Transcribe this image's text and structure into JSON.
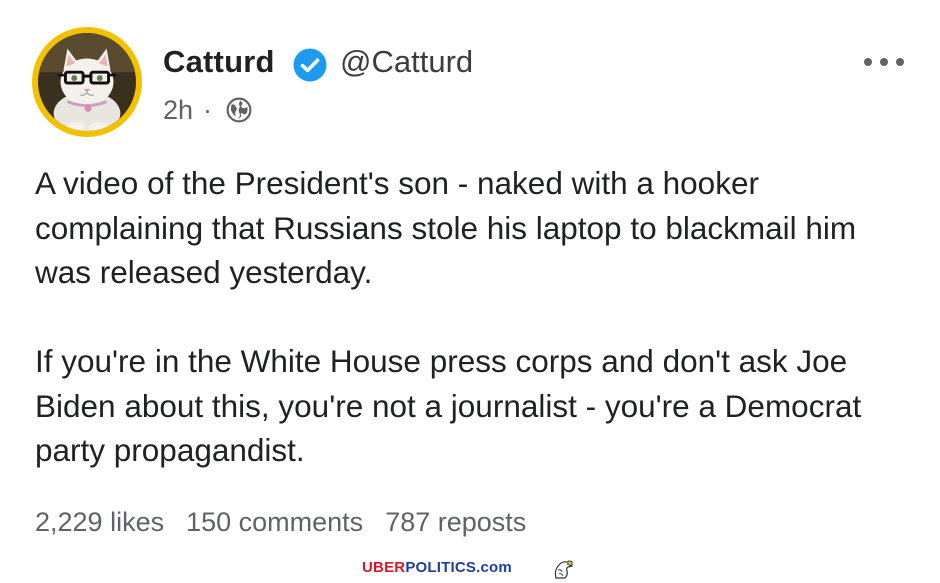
{
  "post": {
    "author_name": "Catturd",
    "handle": "@Catturd",
    "time": "2h",
    "separator": "·",
    "verified_icon": "verified-check-icon",
    "visibility_icon": "globe-icon",
    "more_icon": "more-dots-icon",
    "paragraphs": [
      "A video of the President's son - naked with a hooker complaining that Russians stole his laptop to blackmail him was released yesterday.",
      "If you're in the White House press corps and don't ask Joe Biden about this, you're not a journalist - you're a Democrat party propagandist."
    ]
  },
  "stats": {
    "likes": "2,229 likes",
    "comments": "150 comments",
    "reposts": "787 reposts"
  },
  "watermark": {
    "part1": "UBER",
    "part2": "POLITICS",
    "part3": ".com",
    "icon": "eagle-icon"
  },
  "colors": {
    "avatar_ring": "#f2c200",
    "verified_blue": "#1d9bf0",
    "text": "#202124",
    "muted": "#5f6368",
    "watermark_red": "#d4182b",
    "watermark_blue": "#1d3f9b"
  }
}
